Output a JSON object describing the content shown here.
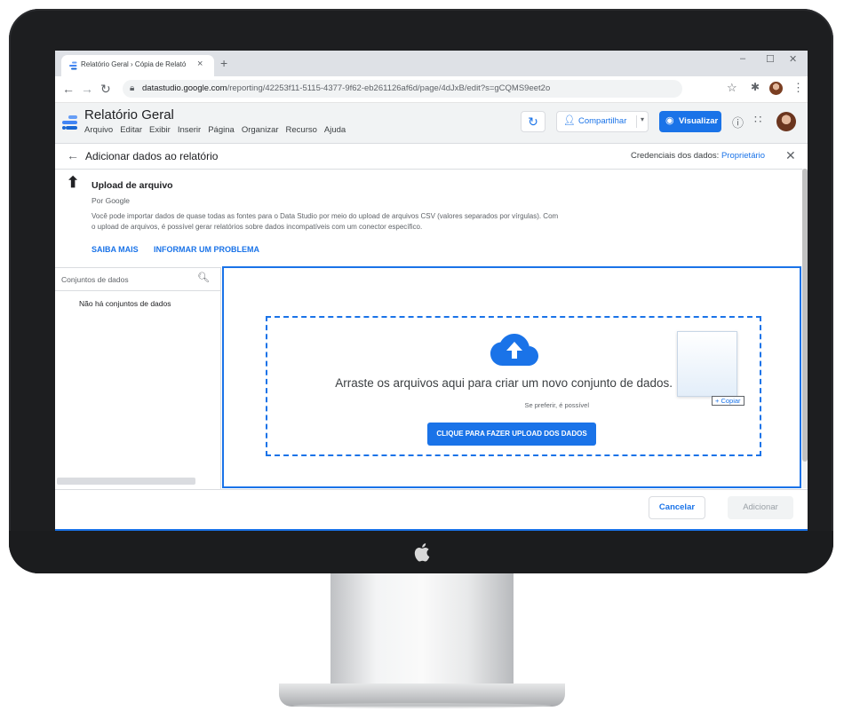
{
  "browser": {
    "tab_title": "Relatório Geral › Cópia de Relató",
    "tab_close": "×",
    "new_tab": "+",
    "window_controls": {
      "minimize": "–",
      "maximize": "☐",
      "close": "✕"
    },
    "url_host": "datastudio.google.com",
    "url_path": "/reporting/42253f11-5115-4377-9f62-eb261126af6d/page/4dJxB/edit?s=gCQMS9eet2o",
    "icons": [
      "back-arrow",
      "forward-arrow",
      "reload",
      "lock",
      "star",
      "extensions",
      "profile",
      "menu"
    ]
  },
  "app": {
    "report_title": "Relatório Geral",
    "menu": [
      "Arquivo",
      "Editar",
      "Exibir",
      "Inserir",
      "Página",
      "Organizar",
      "Recurso",
      "Ajuda"
    ],
    "share_label": "Compartilhar",
    "view_label": "Visualizar",
    "accent_color": "#1a73e8"
  },
  "panel": {
    "title": "Adicionar dados ao relatório",
    "credentials_label": "Credenciais dos dados:",
    "credentials_value": "Proprietário"
  },
  "connector": {
    "name": "Upload de arquivo",
    "by": "Por Google",
    "description": "Você pode importar dados de quase todas as fontes para o Data Studio por meio do upload de arquivos CSV (valores separados por vírgulas). Com o upload de arquivos, é possível gerar relatórios sobre dados incompatíveis com um conector específico.",
    "learn_more": "SAIBA MAIS",
    "report_problem": "INFORMAR UM PROBLEMA"
  },
  "datasets": {
    "search_placeholder": "Conjuntos de dados",
    "empty_message": "Não há conjuntos de dados"
  },
  "dropzone": {
    "message": "Arraste os arquivos aqui para criar um novo conjunto de dados.",
    "alternative": "Se preferir, é possível",
    "upload_button": "CLIQUE PARA FAZER UPLOAD DOS DADOS",
    "copy_tag": "+ Copiar"
  },
  "footer": {
    "cancel": "Cancelar",
    "add": "Adicionar"
  }
}
